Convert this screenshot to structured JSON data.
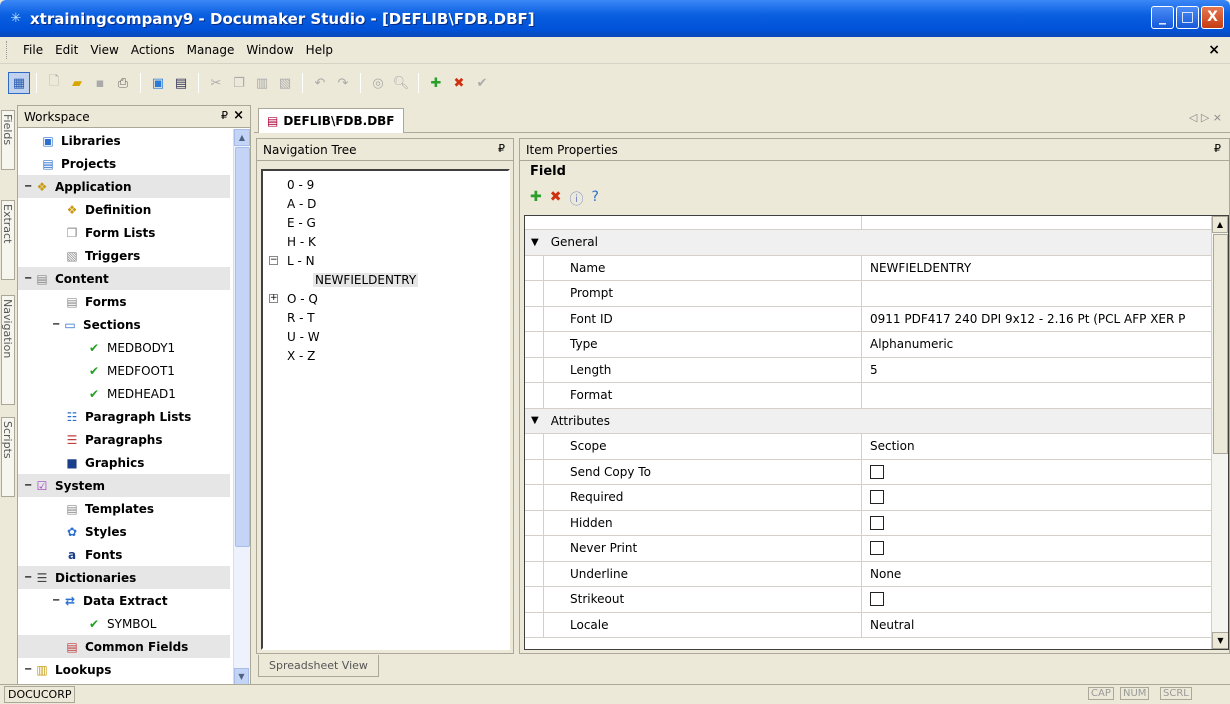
{
  "window": {
    "title": "xtrainingcompany9 - Documaker Studio - [DEFLIB\\FDB.DBF]",
    "min": "_",
    "max": "□",
    "close": "X"
  },
  "menu": {
    "items": [
      "File",
      "Edit",
      "View",
      "Actions",
      "Manage",
      "Window",
      "Help"
    ],
    "mdi_close": "×"
  },
  "side_tabs": [
    "Fields",
    "Extract",
    "Navigation",
    "Scripts"
  ],
  "workspace": {
    "title": "Workspace",
    "pin": "₽",
    "close": "×",
    "items": [
      {
        "label": "Libraries",
        "bold": true
      },
      {
        "label": "Projects",
        "bold": true
      },
      {
        "label": "Application",
        "bold": true
      },
      {
        "label": "Definition",
        "bold": true
      },
      {
        "label": "Form Lists",
        "bold": true
      },
      {
        "label": "Triggers",
        "bold": true
      },
      {
        "label": "Content",
        "bold": true
      },
      {
        "label": "Forms",
        "bold": true
      },
      {
        "label": "Sections",
        "bold": true
      },
      {
        "label": "MEDBODY1",
        "bold": false
      },
      {
        "label": "MEDFOOT1",
        "bold": false
      },
      {
        "label": "MEDHEAD1",
        "bold": false
      },
      {
        "label": "Paragraph Lists",
        "bold": true
      },
      {
        "label": "Paragraphs",
        "bold": true
      },
      {
        "label": "Graphics",
        "bold": true
      },
      {
        "label": "System",
        "bold": true
      },
      {
        "label": "Templates",
        "bold": true
      },
      {
        "label": "Styles",
        "bold": true
      },
      {
        "label": "Fonts",
        "bold": true
      },
      {
        "label": "Dictionaries",
        "bold": true
      },
      {
        "label": "Data Extract",
        "bold": true
      },
      {
        "label": "SYMBOL",
        "bold": false
      },
      {
        "label": "Common Fields",
        "bold": true
      },
      {
        "label": "Lookups",
        "bold": true
      }
    ]
  },
  "doc_tab": {
    "label": "DEFLIB\\FDB.DBF",
    "nav": "◁ ▷ ×"
  },
  "nav_tree": {
    "title": "Navigation Tree",
    "items": [
      "0 - 9",
      "A - D",
      "E - G",
      "H - K",
      "L - N",
      "NEWFIELDENTRY",
      "O - Q",
      "R - T",
      "U - W",
      "X - Z"
    ],
    "expanded": "−",
    "collapsed": "+"
  },
  "spreadsheet_tab": "Spreadsheet View",
  "item_props": {
    "title": "Item Properties",
    "field_label": "Field",
    "categories": {
      "general": "General",
      "attributes": "Attributes"
    },
    "general": [
      {
        "key": "Name",
        "value": "NEWFIELDENTRY"
      },
      {
        "key": "Prompt",
        "value": ""
      },
      {
        "key": "Font ID",
        "value": "0911 PDF417 240 DPI 9x12 - 2.16 Pt (PCL AFP XER P"
      },
      {
        "key": "Type",
        "value": "Alphanumeric"
      },
      {
        "key": "Length",
        "value": "5"
      },
      {
        "key": "Format",
        "value": ""
      }
    ],
    "attributes": [
      {
        "key": "Scope",
        "value": "Section"
      },
      {
        "key": "Send Copy To",
        "value": ""
      },
      {
        "key": "Required",
        "value": ""
      },
      {
        "key": "Hidden",
        "value": ""
      },
      {
        "key": "Never Print",
        "value": ""
      },
      {
        "key": "Underline",
        "value": "None"
      },
      {
        "key": "Strikeout",
        "value": ""
      },
      {
        "key": "Locale",
        "value": "Neutral"
      }
    ]
  },
  "status": {
    "left": "DOCUCORP",
    "cap": "CAP",
    "num": "NUM",
    "scrl": "SCRL"
  }
}
